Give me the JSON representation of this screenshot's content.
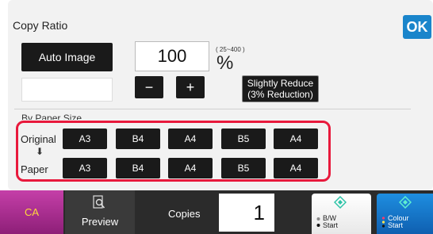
{
  "dialog": {
    "title": "Copy Ratio",
    "ok_label": "OK",
    "auto_image_label": "Auto Image",
    "ratio_value": "100",
    "ratio_range": "( 25~400 )",
    "percent_symbol": "%",
    "minus_label": "−",
    "plus_label": "+",
    "slightly_reduce_line1": "Slightly Reduce",
    "slightly_reduce_line2": "(3% Reduction)",
    "section_label": "By Paper Size",
    "original_label": "Original",
    "paper_label": "Paper",
    "arrow_glyph": "⬇",
    "original_sizes": [
      "A3",
      "B4",
      "A4",
      "B5",
      "A4"
    ],
    "paper_sizes": [
      "A3",
      "B4",
      "A4",
      "B5",
      "A4"
    ]
  },
  "bottom": {
    "ca_label": "CA",
    "preview_label": "Preview",
    "copies_label": "Copies",
    "copies_value": "1",
    "bw_line1": "B/W",
    "bw_line2": "Start",
    "colour_line1": "Colour",
    "colour_line2": "Start"
  },
  "colors": {
    "highlight": "#e8193c",
    "ok": "#1a85cb",
    "ca": "#b2359b",
    "colour_start": "#1a7fd4"
  },
  "icons": {
    "preview": "magnifier-document-icon",
    "bw_start": "diamond-start-icon",
    "colour_start": "diamond-start-icon"
  }
}
